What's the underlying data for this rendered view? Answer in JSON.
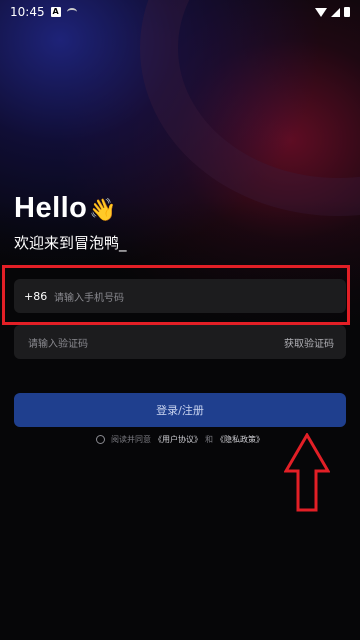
{
  "status_bar": {
    "time": "10:45"
  },
  "header": {
    "hello": "Hello",
    "welcome": "欢迎来到冒泡鸭_"
  },
  "phone_field": {
    "country_code": "+86",
    "placeholder": "请输入手机号码"
  },
  "code_field": {
    "placeholder": "请输入验证码",
    "get_code": "获取验证码"
  },
  "login_button": {
    "label": "登录/注册"
  },
  "agreement": {
    "prefix": "阅读并同意",
    "user_agreement": "《用户协议》",
    "and": "和",
    "privacy_policy": "《隐私政策》"
  },
  "colors": {
    "accent_button": "#1f3f8e",
    "annotation_red": "#e21f26",
    "background": "#060608"
  }
}
